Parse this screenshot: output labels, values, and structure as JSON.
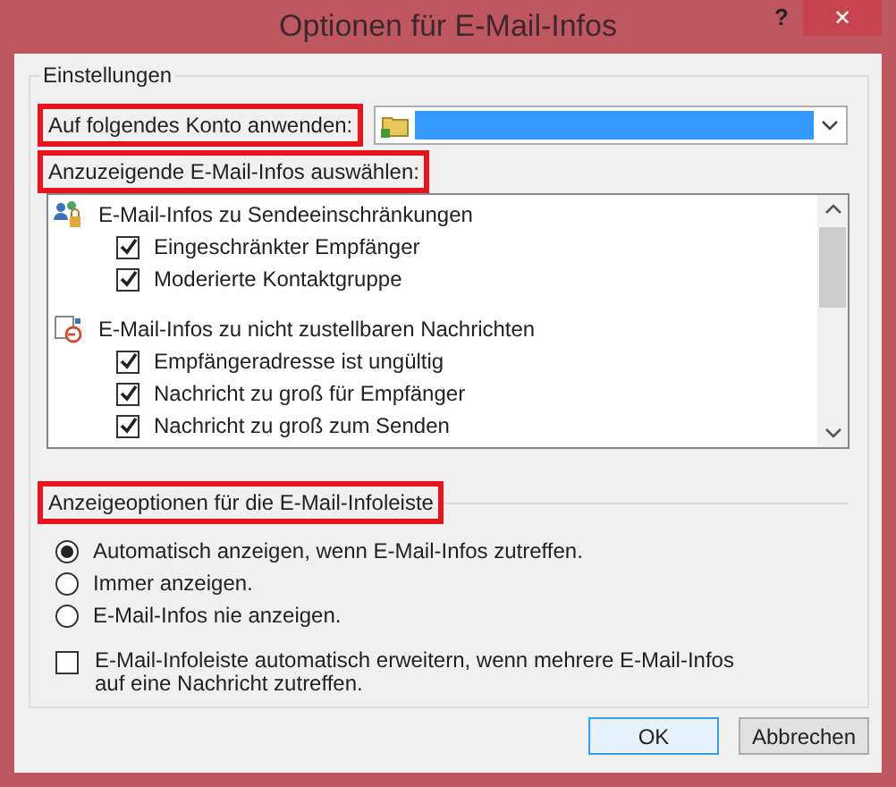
{
  "window": {
    "title": "Optionen für E-Mail-Infos",
    "help": "?",
    "close": "✕"
  },
  "settings": {
    "title": "Einstellungen",
    "account": {
      "label": "Auf folgendes Konto anwenden:",
      "highlighted": true
    },
    "tips": {
      "label": "Anzuzeigende E-Mail-Infos auswählen:",
      "highlighted": true,
      "groups": [
        {
          "kind": "restriction",
          "label": "E-Mail-Infos zu Sendeeinschränkungen",
          "items": [
            {
              "label": "Eingeschränkter Empfänger",
              "checked": true
            },
            {
              "label": "Moderierte Kontaktgruppe",
              "checked": true
            }
          ]
        },
        {
          "kind": "undeliverable",
          "label": "E-Mail-Infos zu nicht zustellbaren Nachrichten",
          "items": [
            {
              "label": "Empfängeradresse ist ungültig",
              "checked": true
            },
            {
              "label": "Nachricht zu groß für Empfänger",
              "checked": true
            },
            {
              "label": "Nachricht zu groß zum Senden",
              "checked": true
            }
          ]
        }
      ]
    },
    "display": {
      "label": "Anzeigeoptionen für die E-Mail-Infoleiste",
      "highlighted": true,
      "options": [
        {
          "label": "Automatisch anzeigen, wenn E-Mail-Infos zutreffen.",
          "selected": true
        },
        {
          "label": "Immer anzeigen.",
          "selected": false
        },
        {
          "label": "E-Mail-Infos nie anzeigen.",
          "selected": false
        }
      ],
      "expand": {
        "label": "E-Mail-Infoleiste automatisch erweitern, wenn mehrere E-Mail-Infos auf eine Nachricht zutreffen.",
        "checked": false
      }
    }
  },
  "buttons": [
    {
      "label": "OK",
      "default": true
    },
    {
      "label": "Abbrechen",
      "default": false
    }
  ]
}
